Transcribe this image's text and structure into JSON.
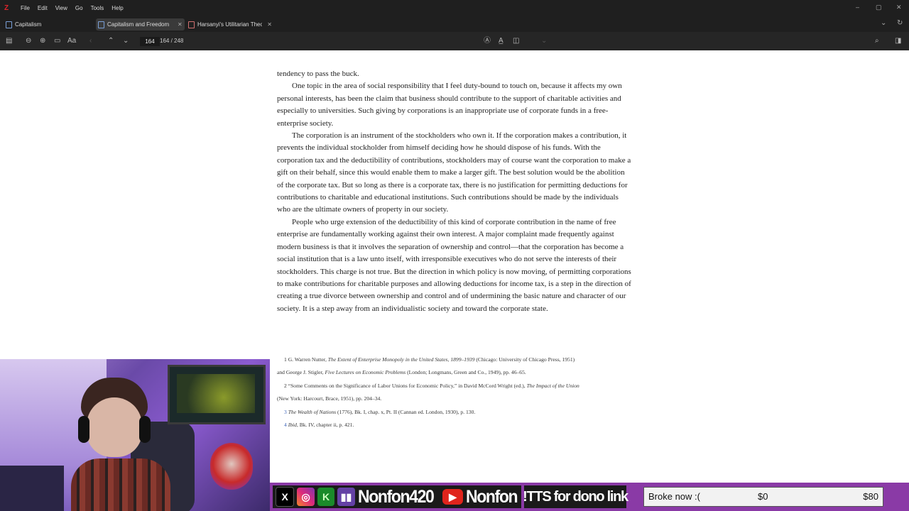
{
  "app": {
    "menu": [
      "File",
      "Edit",
      "View",
      "Go",
      "Tools",
      "Help"
    ],
    "logo_glyph": "Z",
    "window_controls": [
      "–",
      "▢",
      "✕"
    ]
  },
  "tabs": [
    {
      "label": "Capitalism",
      "active": false
    },
    {
      "label": "Capitalism and Freedom",
      "active": true
    },
    {
      "label": "Harsanyi's Utilitarian Theo",
      "active": false
    }
  ],
  "toolbar": {
    "page_input": "164",
    "page_count": "164 / 248",
    "icons": [
      "sidebar-icon",
      "zoom-out-icon",
      "zoom-in-icon",
      "fit-icon",
      "font-icon",
      "back-icon",
      "page-up-icon",
      "page-down-icon",
      "highlight-icon",
      "underline-icon",
      "note-icon",
      "search-icon",
      "context-pane-icon"
    ]
  },
  "document": {
    "paragraphs": [
      {
        "indent": false,
        "text": "tendency to pass the buck."
      },
      {
        "indent": true,
        "text": "One topic in the area of social responsibility that I feel duty-bound to touch on, because it affects my own personal interests, has been the claim that business should contribute to the support of charitable activities and especially to universities. Such giving by corporations is an inappropriate use of corporate funds in a free-enterprise society."
      },
      {
        "indent": true,
        "text": "The corporation is an instrument of the stockholders who own it. If the corporation makes a contribution, it prevents the individual stockholder from himself deciding how he should dispose of his funds. With the corporation tax and the deductibility of contributions, stockholders may of course want the corporation to make a gift on their behalf, since this would enable them to make a larger gift. The best solution would be the abolition of the corporate tax. But so long as there is a corporate tax, there is no justification for permitting deductions for contributions to charitable and educational institutions. Such contributions should be made by the individuals who are the ultimate owners of property in our society."
      },
      {
        "indent": true,
        "text": "People who urge extension of the deductibility of this kind of corporate contribution in the name of free enterprise are fundamentally working against their own interest. A major complaint made frequently against modern business is that it involves the separation of ownership and control—that the corporation has become a social institution that is a law unto itself, with irresponsible executives who do not serve the interests of their stockholders. This charge is not true. But the direction in which policy is now moving, of permitting corporations to make contributions for charitable purposes and allowing deductions for income tax, is a step in the direction of creating a true divorce between ownership and control and of undermining the basic nature and character of our society. It is a step away from an individualistic society and toward the corporate state."
      }
    ],
    "footnotes": [
      {
        "num": "1",
        "pre": "G. Warren Nutter, ",
        "title": "The Extent of Enterprise Monopoly in the United States, 1899–1939",
        "post": " (Chicago: University of Chicago Press, 1951)"
      },
      {
        "num": "",
        "pre": "and George J. Stigler, ",
        "title": "Five Lectures on Economic Problems",
        "post": " (London; Longmans, Green and Co., 1949), pp. 46–65."
      },
      {
        "num": "2",
        "pre": "“Some Comments on the Significance of Labor Unions for Economic Policy,” in David McCord Wright (ed.), ",
        "title": "The Impact of the Union",
        "post": ""
      },
      {
        "num": "",
        "pre": "(New York: Harcourt, Brace, 1951), pp. 204–34.",
        "title": "",
        "post": ""
      },
      {
        "num": "3",
        "pre": "",
        "title": "The Wealth of Nations",
        "post": " (1776), Bk. I, chap. x, Pt. II (Cannan ed. London, 1930), p. 130."
      },
      {
        "num": "4",
        "pre": "",
        "title": "Ibid",
        "post": ", Bk. IV, chapter ii, p. 421."
      }
    ]
  },
  "stream": {
    "handle_1": "Nonfon420",
    "handle_2": "Nonfon",
    "tts": "!TTS for dono link",
    "goal_label": "Broke now :(",
    "goal_current": "$0",
    "goal_target": "$80",
    "goal_progress": 0
  }
}
